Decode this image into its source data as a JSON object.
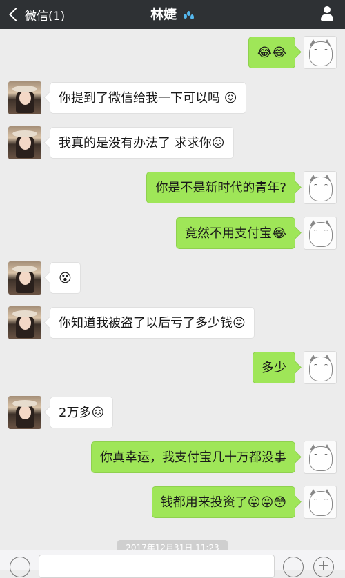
{
  "header": {
    "back_label": "微信(1)",
    "title": "林婕",
    "title_emoji_icon": "water-drops-icon",
    "profile_icon": "user-icon"
  },
  "messages": [
    {
      "side": "right",
      "text": "😂😂"
    },
    {
      "side": "left",
      "text": "你提到了微信给我一下可以吗 😖"
    },
    {
      "side": "left",
      "text": "我真的是没有办法了 求求你😖"
    },
    {
      "side": "right",
      "text": "你是不是新时代的青年?"
    },
    {
      "side": "right",
      "text": "竟然不用支付宝😂"
    },
    {
      "side": "left",
      "text": "😵"
    },
    {
      "side": "left",
      "text": "你知道我被盗了以后亏了多少钱😖"
    },
    {
      "side": "right",
      "text": "多少"
    },
    {
      "side": "left",
      "text": "2万多😖"
    },
    {
      "side": "right",
      "text": "你真幸运，我支付宝几十万都没事"
    },
    {
      "side": "right",
      "text": "钱都用来投资了😝😝😳"
    }
  ],
  "timestamp": "2017年12月31日 11:23",
  "colors": {
    "header_bg": "#2e3134",
    "chat_bg": "#ececec",
    "sent_bubble": "#9fe658",
    "received_bubble": "#ffffff"
  }
}
